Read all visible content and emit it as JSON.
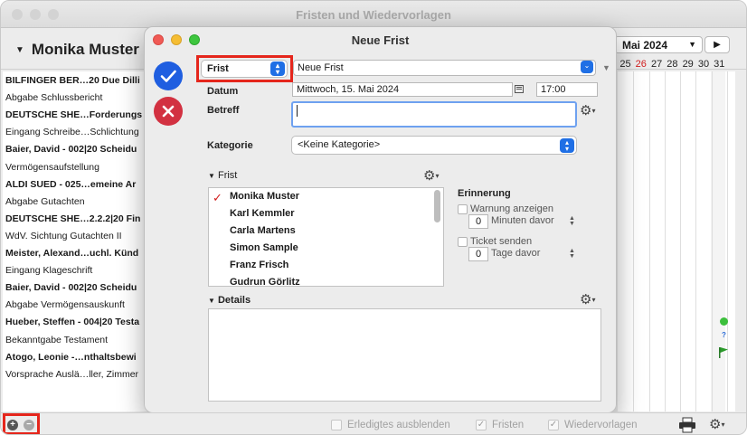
{
  "window": {
    "title": "Fristen und Wiedervorlagen"
  },
  "header": {
    "person": "Monika Muster",
    "month": "Mai 2024",
    "next_label": "▶"
  },
  "calendar": {
    "days": [
      "25",
      "26",
      "27",
      "28",
      "29",
      "30",
      "31"
    ],
    "highlight_day": "26",
    "question_label": "?"
  },
  "list_rows": [
    {
      "text": "BILFINGER BER…20 Due Dilli",
      "bold": true
    },
    {
      "text": "Abgabe Schlussbericht",
      "bold": false
    },
    {
      "text": "DEUTSCHE SHE…Forderungs",
      "bold": true
    },
    {
      "text": "Eingang Schreibe…Schlichtung",
      "bold": false
    },
    {
      "text": "Baier, David - 002|20 Scheidu",
      "bold": true
    },
    {
      "text": "Vermögensaufstellung",
      "bold": false
    },
    {
      "text": "ALDI SUED - 025…emeine Ar",
      "bold": true
    },
    {
      "text": "Abgabe Gutachten",
      "bold": false
    },
    {
      "text": "DEUTSCHE SHE…2.2.2|20 Fin",
      "bold": true
    },
    {
      "text": "WdV. Sichtung Gutachten II",
      "bold": false
    },
    {
      "text": "Meister, Alexand…uchl. Künd",
      "bold": true
    },
    {
      "text": "Eingang Klageschrift",
      "bold": false
    },
    {
      "text": "Baier, David - 002|20 Scheidu",
      "bold": true
    },
    {
      "text": "Abgabe Vermögensauskunft",
      "bold": false
    },
    {
      "text": "Hueber, Steffen - 004|20 Testa",
      "bold": true
    },
    {
      "text": "Bekanntgabe Testament",
      "bold": false
    },
    {
      "text": "Atogo, Leonie -…nthaltsbewi",
      "bold": true
    },
    {
      "text": "Vorsprache Auslä…ller, Zimmer",
      "bold": false
    }
  ],
  "sheet": {
    "title": "Neue Frist",
    "type_value": "Frist",
    "name_value": "Neue Frist",
    "datum_label": "Datum",
    "date_value": "Mittwoch, 15. Mai 2024",
    "time_value": "17:00",
    "betreff_label": "Betreff",
    "betreff_value": "",
    "kategorie_label": "Kategorie",
    "kategorie_value": "<Keine Kategorie>",
    "frist_section": "Frist",
    "people": [
      "Monika Muster",
      "Karl Kemmler",
      "Carla Martens",
      "Simon Sample",
      "Franz Frisch",
      "Gudrun Görlitz"
    ],
    "erinnerung_label": "Erinnerung",
    "warnung_label": "Warnung anzeigen",
    "warnung_value": "0",
    "minuten_label": "Minuten davor",
    "ticket_label": "Ticket senden",
    "ticket_value": "0",
    "tage_label": "Tage davor",
    "details_label": "Details"
  },
  "bottom": {
    "erledigtes": "Erledigtes ausblenden",
    "fristen": "Fristen",
    "wiedervorlagen": "Wiedervorlagen"
  },
  "colors": {
    "accent": "#1f6fe5",
    "confirm": "#1f5ee0",
    "cancel": "#d23141",
    "highlight": "#e5261c",
    "flag": "#2a9a2a"
  }
}
